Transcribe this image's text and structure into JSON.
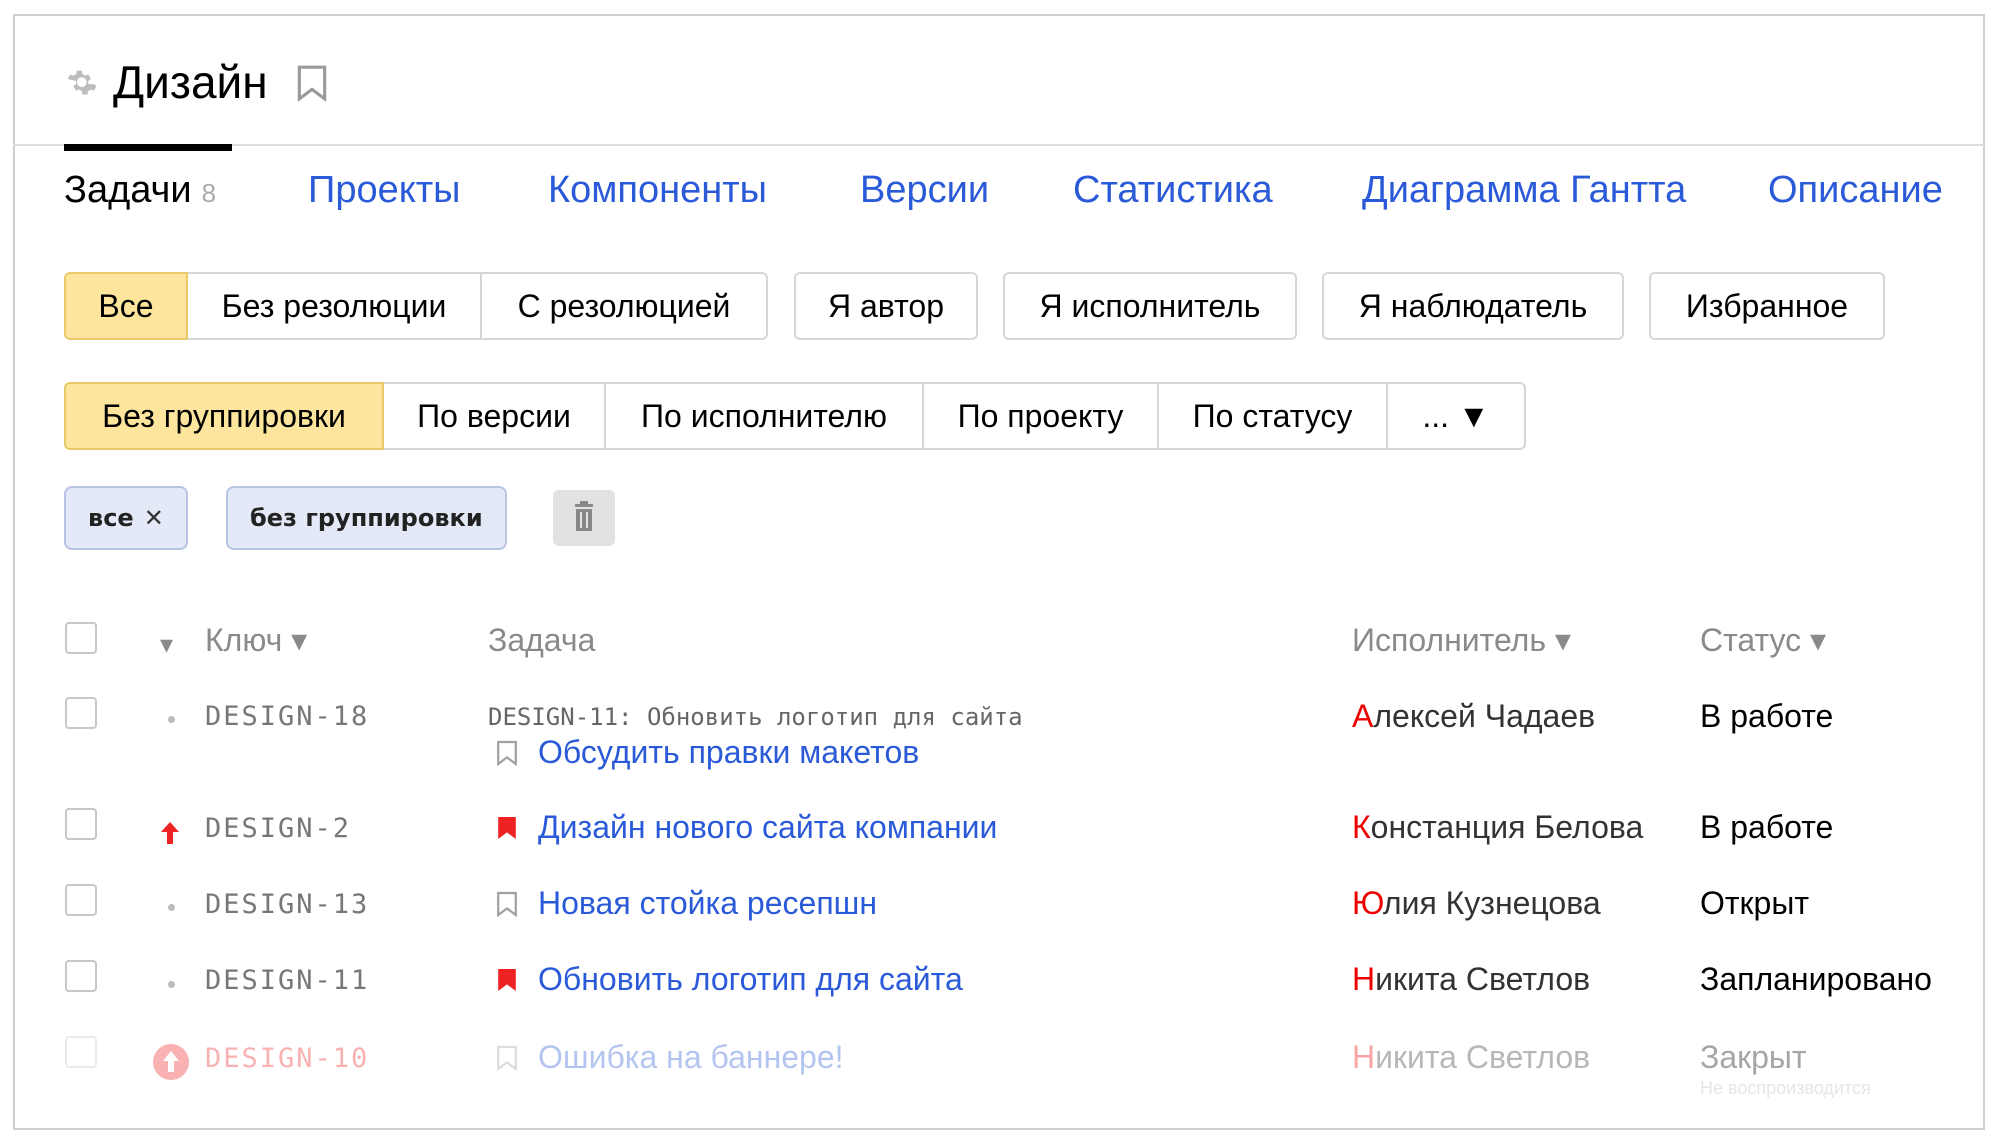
{
  "project": {
    "title": "Дизайн"
  },
  "tabs": [
    {
      "label": "Задачи",
      "count": "8"
    },
    {
      "label": "Проекты"
    },
    {
      "label": "Компоненты"
    },
    {
      "label": "Версии"
    },
    {
      "label": "Статистика"
    },
    {
      "label": "Диаграмма Гантта"
    },
    {
      "label": "Описание"
    }
  ],
  "filters": {
    "resolution": [
      "Все",
      "Без резолюции",
      "С резолюцией"
    ],
    "roles": [
      "Я автор",
      "Я исполнитель",
      "Я наблюдатель",
      "Избранное"
    ],
    "selected": "Все"
  },
  "grouping": {
    "options": [
      "Без группировки",
      "По версии",
      "По исполнителю",
      "По проекту",
      "По статусу",
      "... ▼"
    ],
    "selected": "Без группировки"
  },
  "active_filters": [
    {
      "label": "все",
      "removable": true
    },
    {
      "label": "без группировки",
      "removable": false
    }
  ],
  "table": {
    "headers": {
      "key": "Ключ ▾",
      "task": "Задача",
      "assignee": "Исполнитель ▾",
      "status": "Статус ▾",
      "sort_arrow": "▾"
    },
    "rows": [
      {
        "priority": "normal",
        "key": "DESIGN-18",
        "parent": "DESIGN-11: Обновить логотип для сайта",
        "bookmarked": false,
        "task": "Обсудить правки макетов",
        "assignee_first": "А",
        "assignee_rest": "лексей Чадаев",
        "status": "В работе"
      },
      {
        "priority": "high",
        "key": "DESIGN-2",
        "parent": "",
        "bookmarked": true,
        "task": "Дизайн нового сайта компании",
        "assignee_first": "К",
        "assignee_rest": "онстанция Белова",
        "status": "В работе"
      },
      {
        "priority": "normal",
        "key": "DESIGN-13",
        "parent": "",
        "bookmarked": false,
        "task": "Новая стойка ресепшн",
        "assignee_first": "Ю",
        "assignee_rest": "лия Кузнецова",
        "status": "Открыт"
      },
      {
        "priority": "normal",
        "key": "DESIGN-11",
        "parent": "",
        "bookmarked": true,
        "task": "Обновить логотип для сайта",
        "assignee_first": "Н",
        "assignee_rest": "икита Светлов",
        "status": "Запланировано"
      },
      {
        "priority": "critical",
        "key": "DESIGN-10",
        "parent": "",
        "bookmarked": false,
        "task": "Ошибка на баннере!",
        "assignee_first": "Н",
        "assignee_rest": "икита Светлов",
        "status": "Закрыт",
        "resolution": "Не воспроизводится",
        "closed": true
      }
    ]
  },
  "colors": {
    "link": "#2a5ad8",
    "selected_button": "#fde59e",
    "chip_bg": "#e4e9f7",
    "accent_red": "#ee2222"
  }
}
